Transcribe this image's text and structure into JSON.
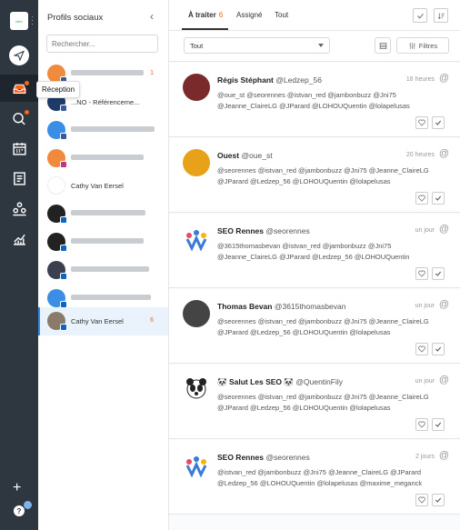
{
  "rail": {
    "logo_text": "iden",
    "tooltip": "Réception",
    "colors": {
      "bg": "#2e3640",
      "accent": "#f4631f"
    },
    "icons": [
      "compose-icon",
      "inbox-icon",
      "search-globe-icon",
      "calendar-icon",
      "list-icon",
      "team-icon",
      "analytics-icon",
      "plus-icon",
      "help-icon"
    ]
  },
  "profiles": {
    "title": "Profils sociaux",
    "search_placeholder": "Rechercher...",
    "items": [
      {
        "name": "",
        "count": "1",
        "network": "fb"
      },
      {
        "name": "...NO - Référenceme...",
        "count": "",
        "network": "fb"
      },
      {
        "name": "",
        "count": "",
        "network": "fb"
      },
      {
        "name": "",
        "count": "",
        "network": "ig"
      },
      {
        "name": "Cathy Van Eersel",
        "count": "",
        "network": "fb"
      },
      {
        "name": "",
        "count": "",
        "network": "li"
      },
      {
        "name": "",
        "count": "",
        "network": "li"
      },
      {
        "name": "",
        "count": "",
        "network": "li"
      },
      {
        "name": "",
        "count": "",
        "network": "li"
      },
      {
        "name": "Cathy Van Eersel",
        "count": "6",
        "network": "li"
      }
    ]
  },
  "main": {
    "tabs": [
      {
        "label": "À traiter",
        "count": "6"
      },
      {
        "label": "Assigné",
        "count": ""
      },
      {
        "label": "Tout",
        "count": ""
      }
    ],
    "filter_select": "Tout",
    "filter_button": "Filtres",
    "cards": [
      {
        "name": "Régis Stéphant",
        "handle": "@Ledzep_56",
        "time": "18 heures",
        "text": "@oue_st @seorennes @istvan_red @jambonbuzz @Jni75 @Jeanne_ClaireLG @JParard @LOHOUQuentin @lolapelusas",
        "avatar_color": "#7a2a2a"
      },
      {
        "name": "Ouest",
        "handle": "@oue_st",
        "time": "20 heures",
        "text": "@seorennes @istvan_red @jambonbuzz @Jni75 @Jeanne_ClaireLG @JParard @Ledzep_56 @LOHOUQuentin @lolapelusas",
        "avatar_color": "#e8a21a"
      },
      {
        "name": "SEO Rennes",
        "handle": "@seorennes",
        "time": "un jour",
        "text": "@3615thomasbevan @istvan_red @jambonbuzz @Jni75 @Jeanne_ClaireLG @JParard @Ledzep_56 @LOHOUQuentin",
        "avatar_color": "#3a7bd5"
      },
      {
        "name": "Thomas Bevan",
        "handle": "@3615thomasbevan",
        "time": "un jour",
        "text": "@seorennes @istvan_red @jambonbuzz @Jni75 @Jeanne_ClaireLG @JParard @Ledzep_56 @LOHOUQuentin @lolapelusas",
        "avatar_color": "#444444"
      },
      {
        "name": "🐼 Salut Les SEO 🐼",
        "handle": "@QuentinFily",
        "time": "un jour",
        "text": "@seorennes @istvan_red @jambonbuzz @Jni75 @Jeanne_ClaireLG @JParard @Ledzep_56 @LOHOUQuentin @lolapelusas",
        "avatar_color": "#222222"
      },
      {
        "name": "SEO Rennes",
        "handle": "@seorennes",
        "time": "2 jours",
        "text": "@istvan_red @jambonbuzz @Jni75 @Jeanne_ClaireLG @JParard @Ledzep_56 @LOHOUQuentin @lolapelusas @maxime_meganck",
        "avatar_color": "#3a7bd5"
      }
    ]
  }
}
